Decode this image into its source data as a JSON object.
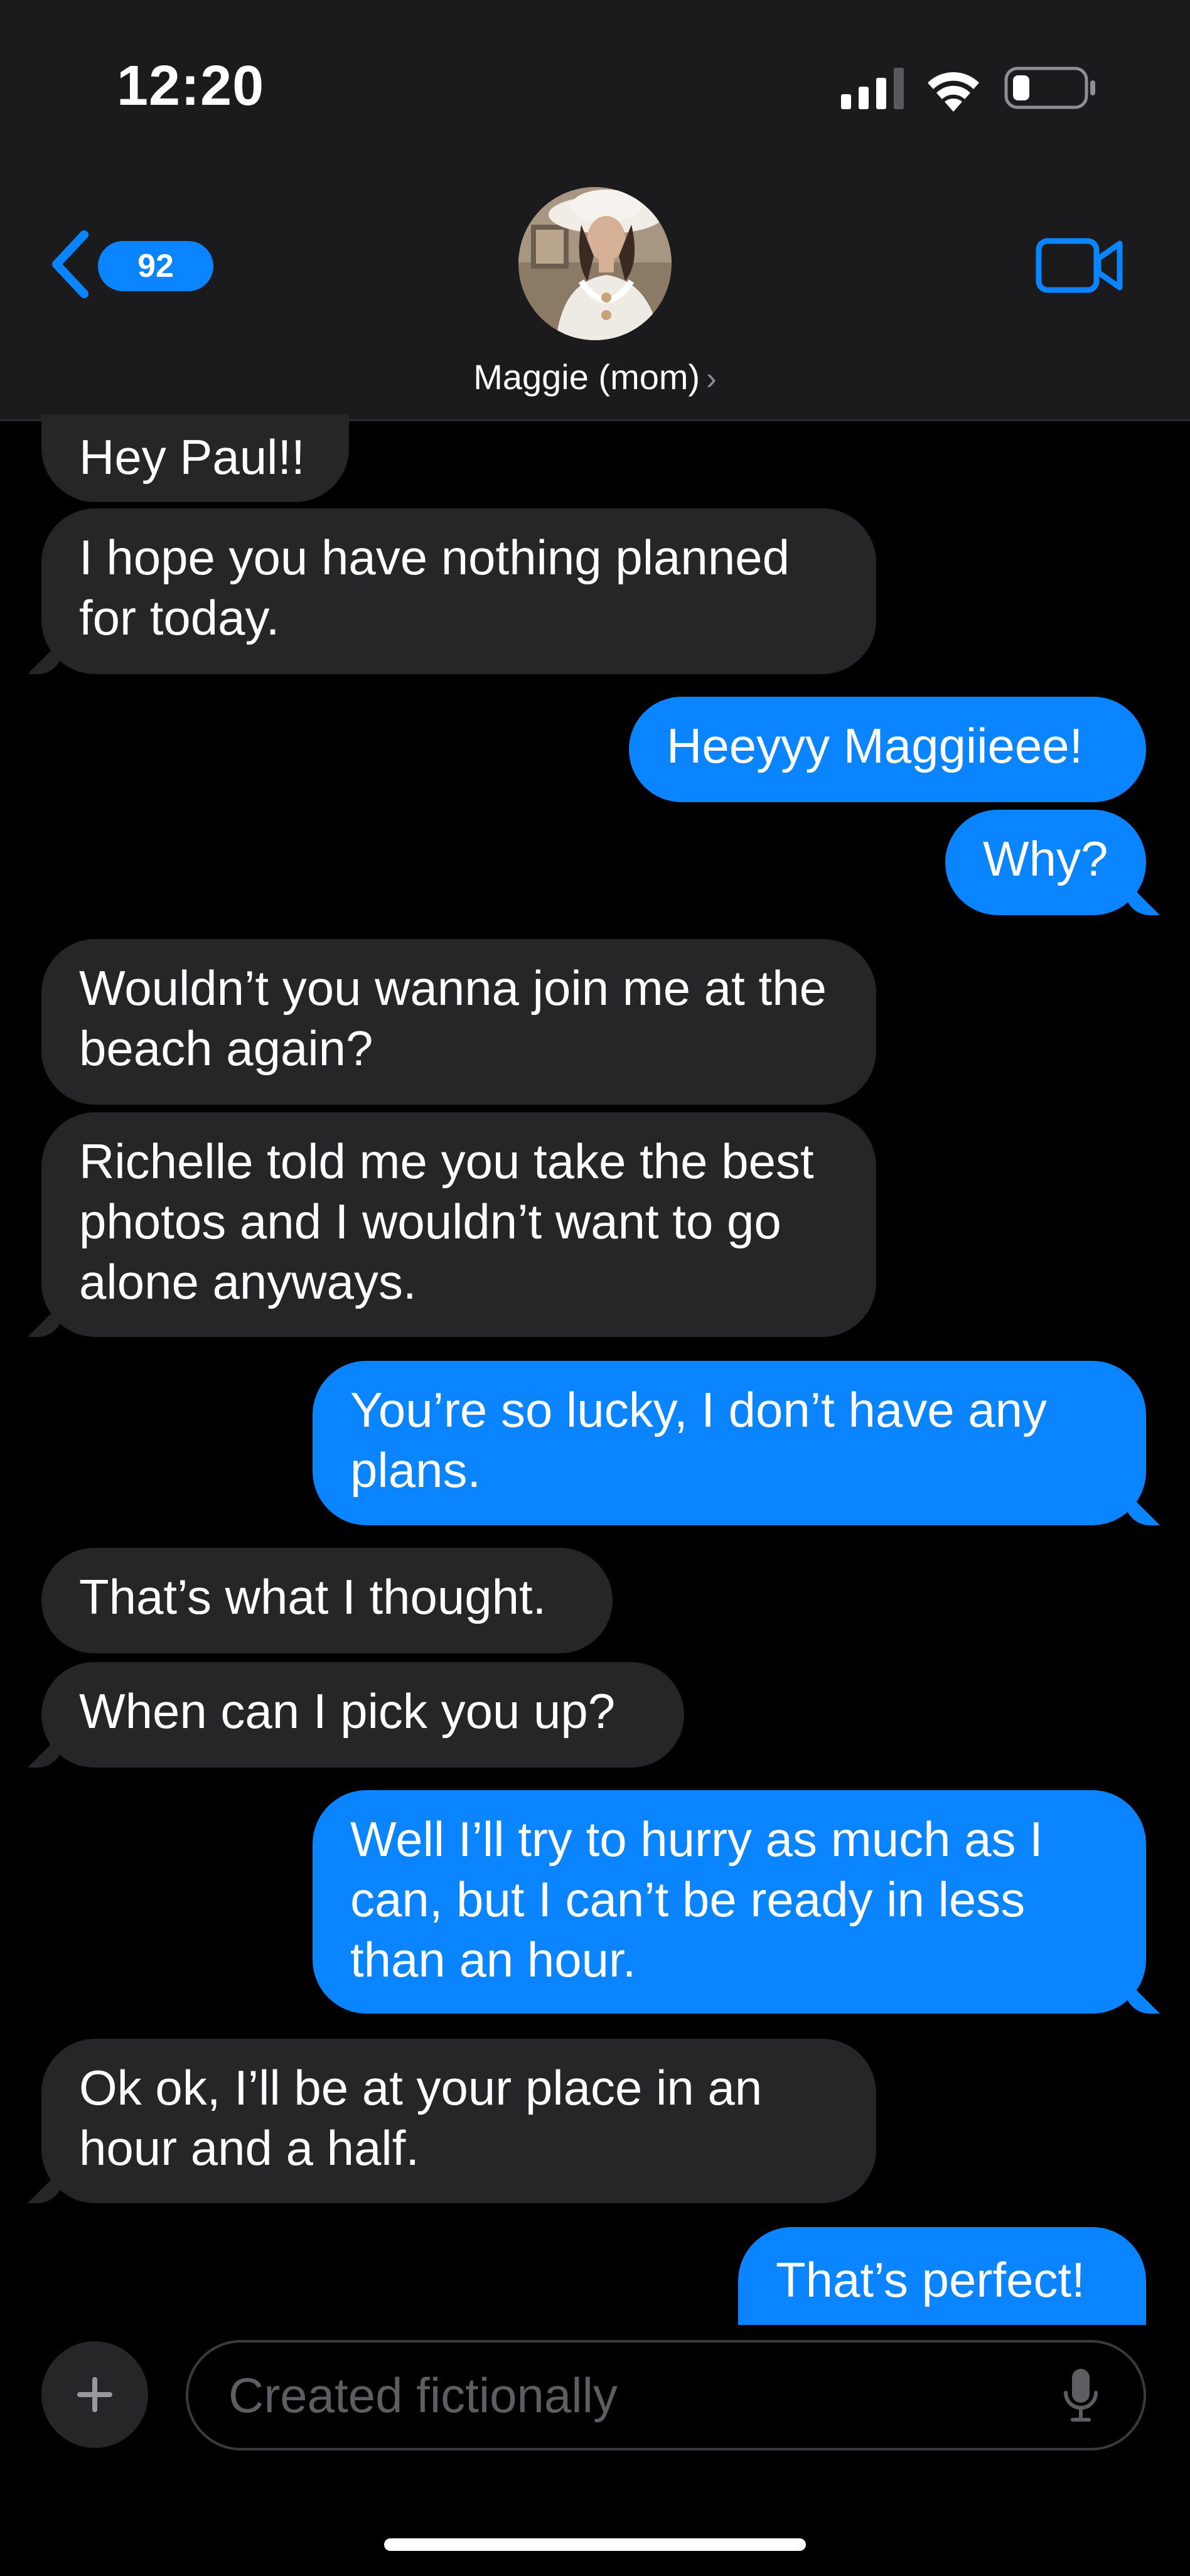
{
  "status_bar": {
    "time": "12:20"
  },
  "header": {
    "back_badge_count": "92",
    "contact_name": "Maggie (mom)",
    "contact_chevron": "›"
  },
  "messages": [
    {
      "from": "them",
      "text": "Hey Paul!!"
    },
    {
      "from": "them",
      "text": "I hope you have nothing planned for today."
    },
    {
      "from": "me",
      "text": "Heeyyy Maggiieee!"
    },
    {
      "from": "me",
      "text": "Why?"
    },
    {
      "from": "them",
      "text": "Wouldn’t you wanna join me at the beach again?"
    },
    {
      "from": "them",
      "text": "Richelle told me you take the best photos and I wouldn’t want to go alone anyways."
    },
    {
      "from": "me",
      "text": "You’re so lucky, I don’t have any plans."
    },
    {
      "from": "them",
      "text": "That’s what I thought."
    },
    {
      "from": "them",
      "text": "When can I pick you up?"
    },
    {
      "from": "me",
      "text": "Well I’ll try to hurry as much as I can, but I can’t be ready in less than an hour."
    },
    {
      "from": "them",
      "text": "Ok ok, I’ll be at your place in an hour and a half."
    },
    {
      "from": "me",
      "text": "That’s perfect!"
    }
  ],
  "composer": {
    "placeholder": "Created fictionally"
  },
  "icons": {
    "back": "chevron-left-icon",
    "video": "video-camera-icon",
    "add": "plus-icon",
    "mic": "microphone-icon"
  },
  "colors": {
    "accent": "#0a84ff",
    "incoming_bubble": "#262628",
    "header_bg": "#1b1b1d",
    "background": "#000000"
  }
}
